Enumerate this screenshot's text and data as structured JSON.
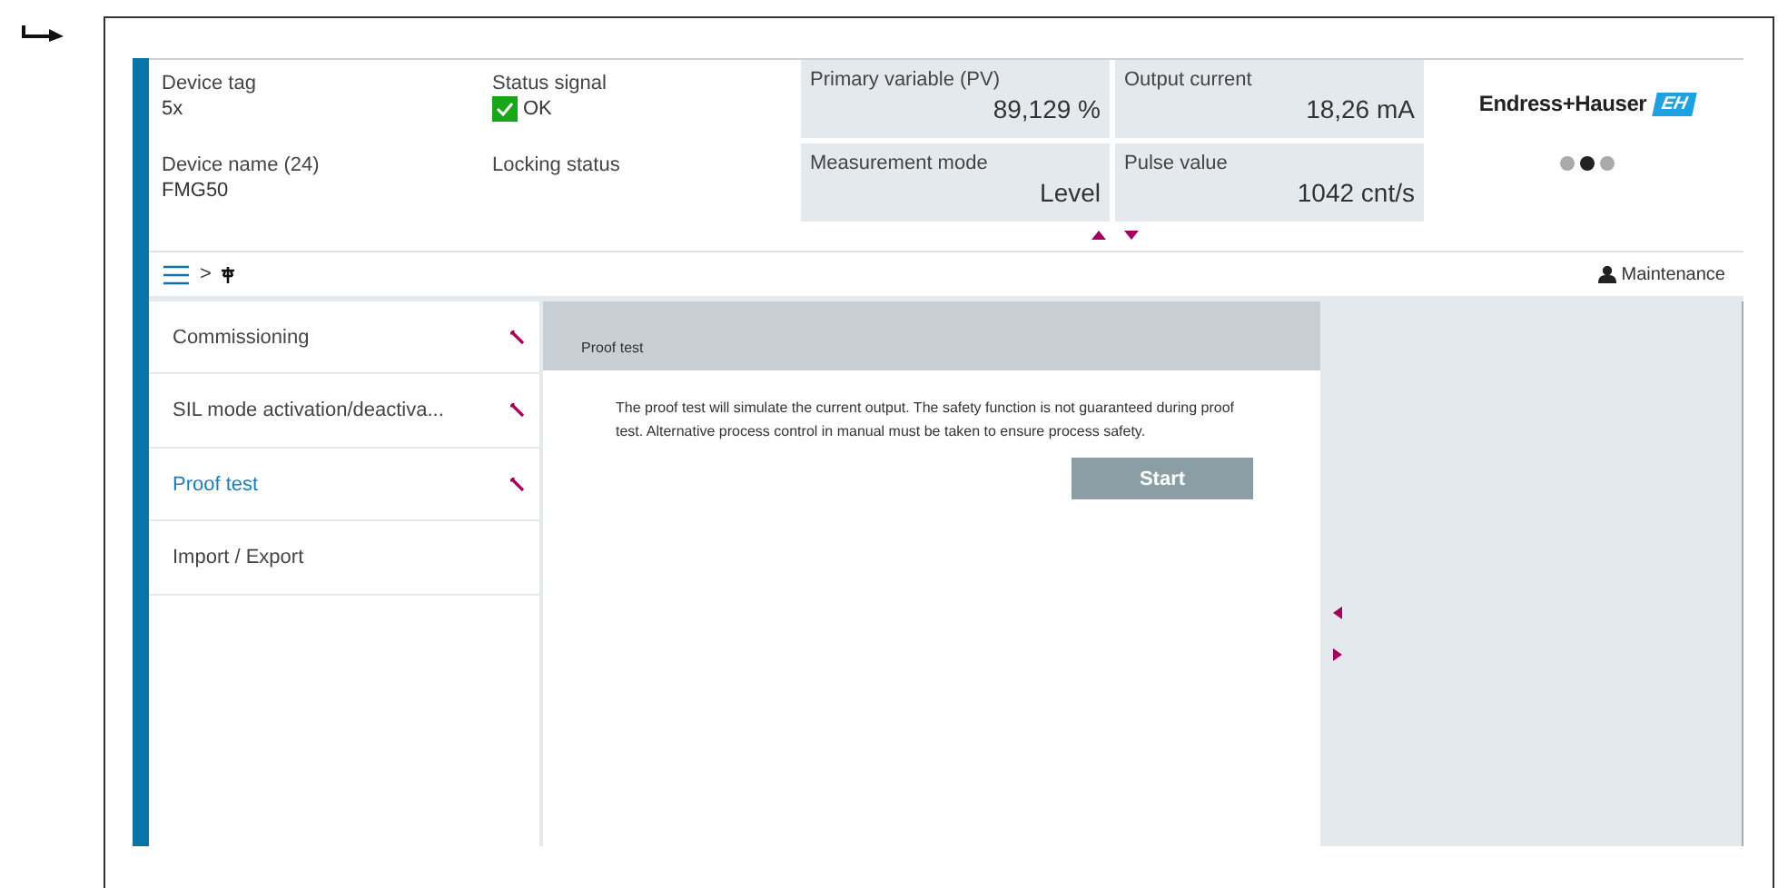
{
  "header": {
    "device_tag": {
      "label": "Device tag",
      "value": "5x"
    },
    "status_signal": {
      "label": "Status signal",
      "value": "OK",
      "ok": true
    },
    "device_name": {
      "label": "Device name (24)",
      "value": "FMG50"
    },
    "locking_status": {
      "label": "Locking status"
    },
    "tiles": [
      {
        "label": "Primary variable (PV)",
        "value": "89,129 %"
      },
      {
        "label": "Output current",
        "value": "18,26 mA"
      },
      {
        "label": "Measurement mode",
        "value": "Level"
      },
      {
        "label": "Pulse value",
        "value": "1042 cnt/s"
      }
    ],
    "logo": {
      "name": "Endress+Hauser",
      "mark": "EH"
    },
    "pages": [
      {
        "selected": false
      },
      {
        "selected": true
      },
      {
        "selected": false
      }
    ]
  },
  "navbar": {
    "separator": ">",
    "user_role": "Maintenance"
  },
  "menu": [
    {
      "label": "Commissioning",
      "selected": false,
      "tool_icon": true
    },
    {
      "label": "SIL mode activation/deactiva...",
      "selected": false,
      "tool_icon": true
    },
    {
      "label": "Proof test",
      "selected": true,
      "tool_icon": true
    },
    {
      "label": "Import / Export",
      "selected": false,
      "tool_icon": false
    }
  ],
  "content": {
    "title": "Proof test",
    "message": "The proof test will simulate the current output. The safety function is not guaranteed during proof test. Alternative process control in manual must be taken to ensure process safety.",
    "button": "Start"
  }
}
